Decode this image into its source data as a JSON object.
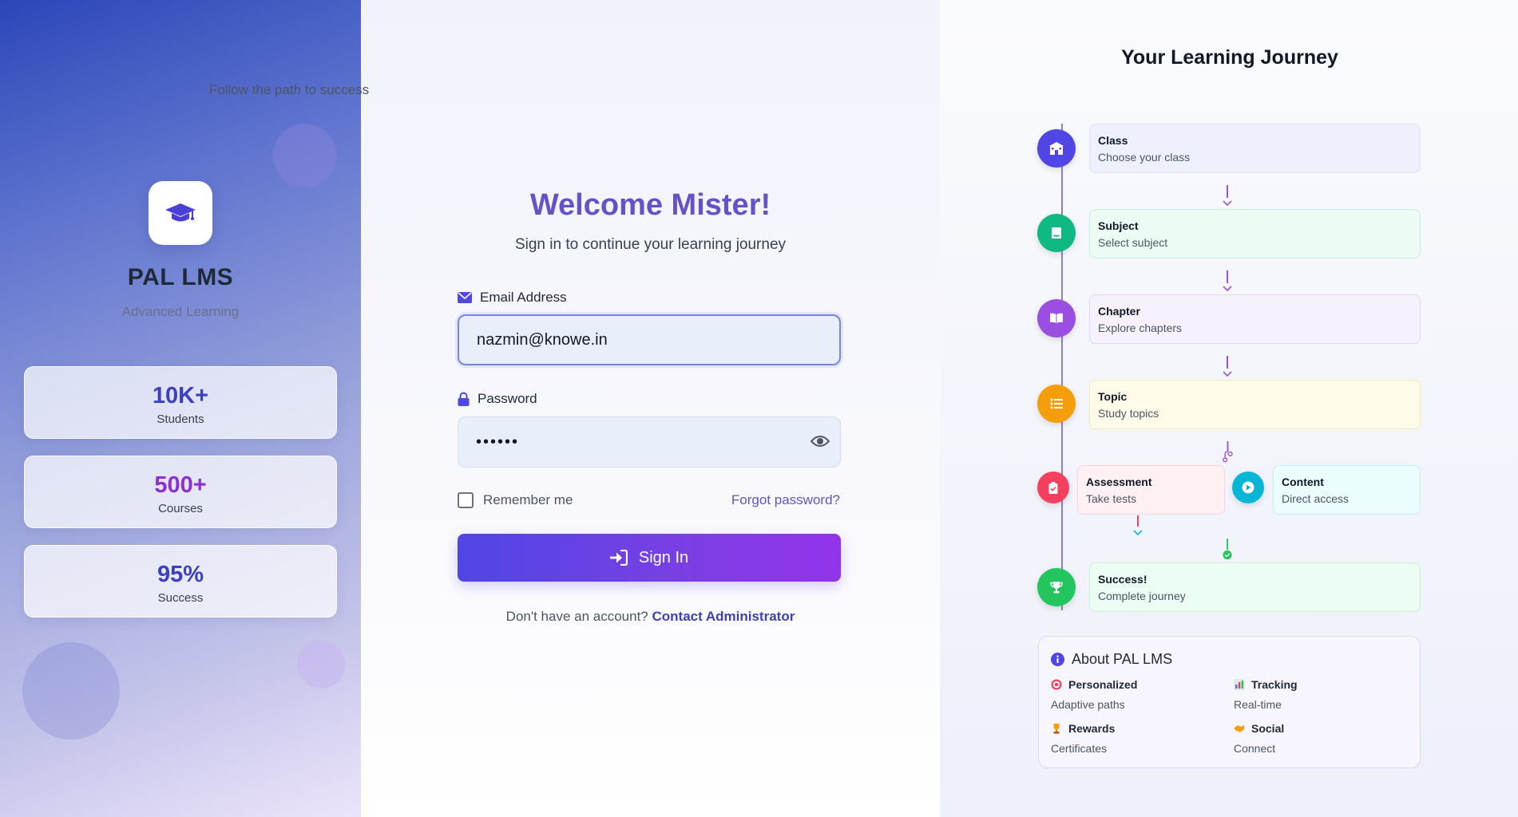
{
  "brand": {
    "title": "PAL LMS",
    "subtitle": "Advanced Learning"
  },
  "stats": [
    {
      "value": "10K+",
      "label": "Students"
    },
    {
      "value": "500+",
      "label": "Courses"
    },
    {
      "value": "95%",
      "label": "Success"
    }
  ],
  "login": {
    "heading": "Welcome Mister!",
    "subheading": "Sign in to continue your learning journey",
    "email_label": "Email Address",
    "email_value": "nazmin@knowe.in",
    "password_label": "Password",
    "password_value": "••••••",
    "remember_label": "Remember me",
    "forgot_label": "Forgot password?",
    "signin_label": "Sign In",
    "no_account_text": "Don't have an account?",
    "contact_label": "Contact Administrator"
  },
  "journey": {
    "title": "Your Learning Journey",
    "subtitle": "Follow the path to success",
    "steps": [
      {
        "title": "Class",
        "desc": "Choose your class",
        "color": "#4f46e5"
      },
      {
        "title": "Subject",
        "desc": "Select subject",
        "color": "#10b981"
      },
      {
        "title": "Chapter",
        "desc": "Explore chapters",
        "color": "#9b4fe0"
      },
      {
        "title": "Topic",
        "desc": "Study topics",
        "color": "#f59e0b"
      },
      {
        "title": "Assessment",
        "desc": "Take tests",
        "color": "#f43f5e"
      },
      {
        "title": "Content",
        "desc": "Direct access",
        "color": "#06b6d4"
      },
      {
        "title": "Success!",
        "desc": "Complete journey",
        "color": "#22c55e"
      }
    ]
  },
  "about": {
    "title": "About PAL LMS",
    "items": [
      {
        "title": "Personalized",
        "desc": "Adaptive paths",
        "icon": "target-icon"
      },
      {
        "title": "Tracking",
        "desc": "Real-time",
        "icon": "bar-chart-icon"
      },
      {
        "title": "Rewards",
        "desc": "Certificates",
        "icon": "trophy-icon"
      },
      {
        "title": "Social",
        "desc": "Connect",
        "icon": "handshake-icon"
      }
    ]
  },
  "colors": {
    "primary": "#4f46e5",
    "accent": "#9333ea",
    "link": "#3f3fb6"
  }
}
